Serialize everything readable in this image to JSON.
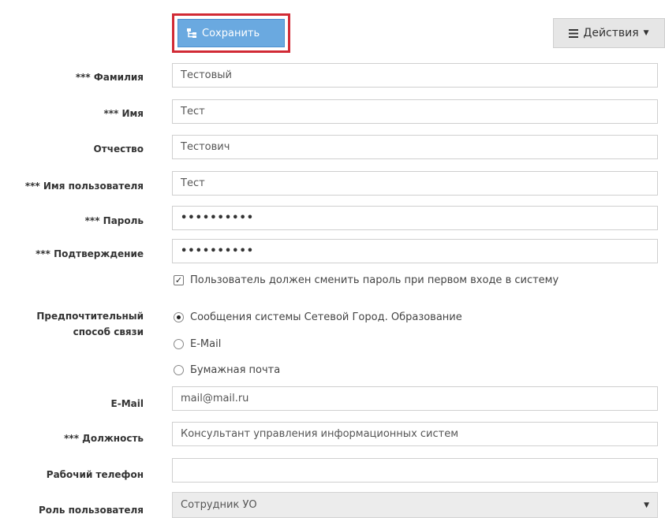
{
  "toolbar": {
    "save_label": "Сохранить",
    "actions_label": "Действия",
    "actions_icon": "hamburger-icon",
    "save_icon": "sitemap-save-icon"
  },
  "form": {
    "last_name": {
      "label": "*** Фамилия",
      "value": "Тестовый"
    },
    "first_name": {
      "label": "*** Имя",
      "value": "Тест"
    },
    "patronymic": {
      "label": "Отчество",
      "value": "Тестович"
    },
    "username": {
      "label": "*** Имя пользователя",
      "value": "Тест"
    },
    "password": {
      "label": "*** Пароль",
      "value": "••••••••••"
    },
    "confirm": {
      "label": "*** Подтверждение",
      "value": "••••••••••"
    },
    "must_change": {
      "label": "Пользователь должен сменить пароль при первом входе в систему",
      "checked": true
    },
    "contact": {
      "label_line1": "Предпочтительный",
      "label_line2": "способ связи",
      "options": [
        {
          "label": "Сообщения системы Сетевой Город. Образование",
          "selected": true
        },
        {
          "label": "E-Mail",
          "selected": false
        },
        {
          "label": "Бумажная почта",
          "selected": false
        }
      ]
    },
    "email": {
      "label": "E-Mail",
      "value": "mail@mail.ru"
    },
    "position": {
      "label": "*** Должность",
      "value": "Консультант управления информационных систем"
    },
    "work_phone": {
      "label": "Рабочий телефон",
      "value": ""
    },
    "role": {
      "label": "Роль пользователя",
      "value": "Сотрудник УО"
    }
  },
  "colors": {
    "save_bg": "#6aa9e0",
    "highlight_border": "#d12a35",
    "actions_bg": "#e6e6e6"
  }
}
